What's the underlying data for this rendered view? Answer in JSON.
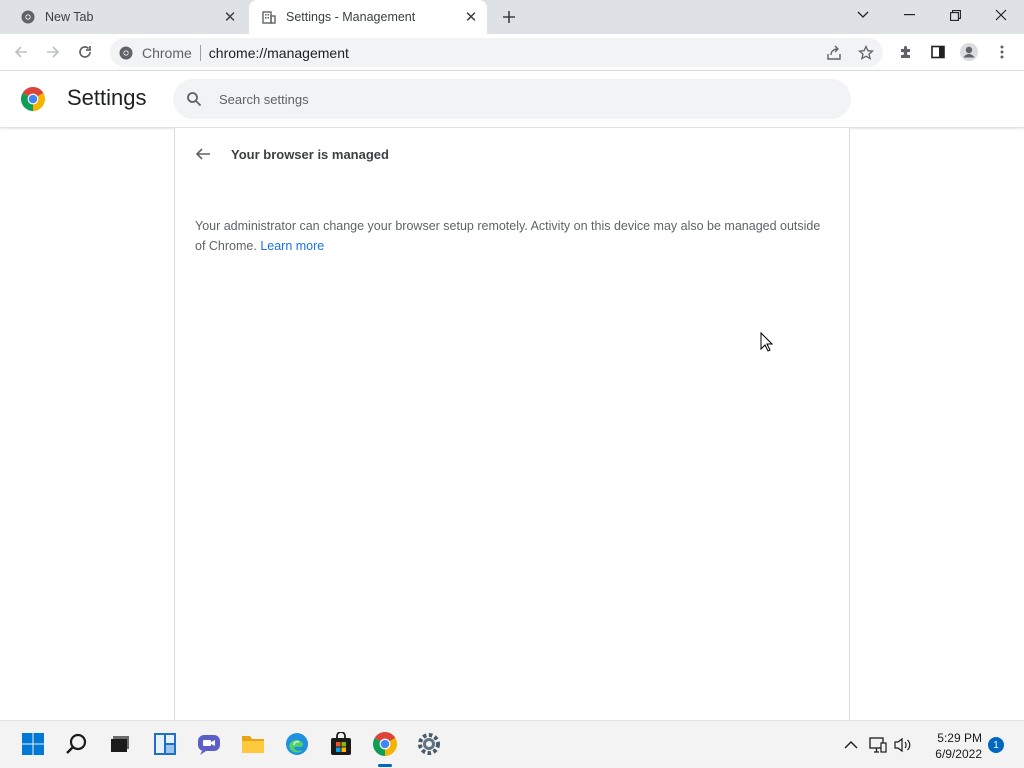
{
  "tabs": [
    {
      "label": "New Tab",
      "icon": "chrome-icon",
      "active": false
    },
    {
      "label": "Settings - Management",
      "icon": "building-icon",
      "active": true
    }
  ],
  "window_controls": [
    "tab-search-icon",
    "minimize-icon",
    "restore-icon",
    "close-icon"
  ],
  "toolbar": {
    "omnibox_chip": "Chrome",
    "omnibox_url": "chrome://management"
  },
  "settings": {
    "title": "Settings",
    "search_placeholder": "Search settings"
  },
  "management": {
    "heading": "Your browser is managed",
    "description": "Your administrator can change your browser setup remotely. Activity on this device may also be managed outside of Chrome.",
    "learn_more": "Learn more"
  },
  "taskbar": {
    "apps": [
      "start-icon",
      "search-icon",
      "task-view-icon",
      "widgets-icon",
      "teams-chat-icon",
      "file-explorer-icon",
      "edge-icon",
      "store-icon",
      "chrome-icon",
      "settings-gear-icon"
    ],
    "active_app": "chrome-icon",
    "time": "5:29 PM",
    "date": "6/9/2022",
    "notification_count": "1"
  },
  "colors": {
    "accent": "#1a73e8",
    "tabstrip": "#dee1e6",
    "taskbar_accent": "#0067c0"
  }
}
